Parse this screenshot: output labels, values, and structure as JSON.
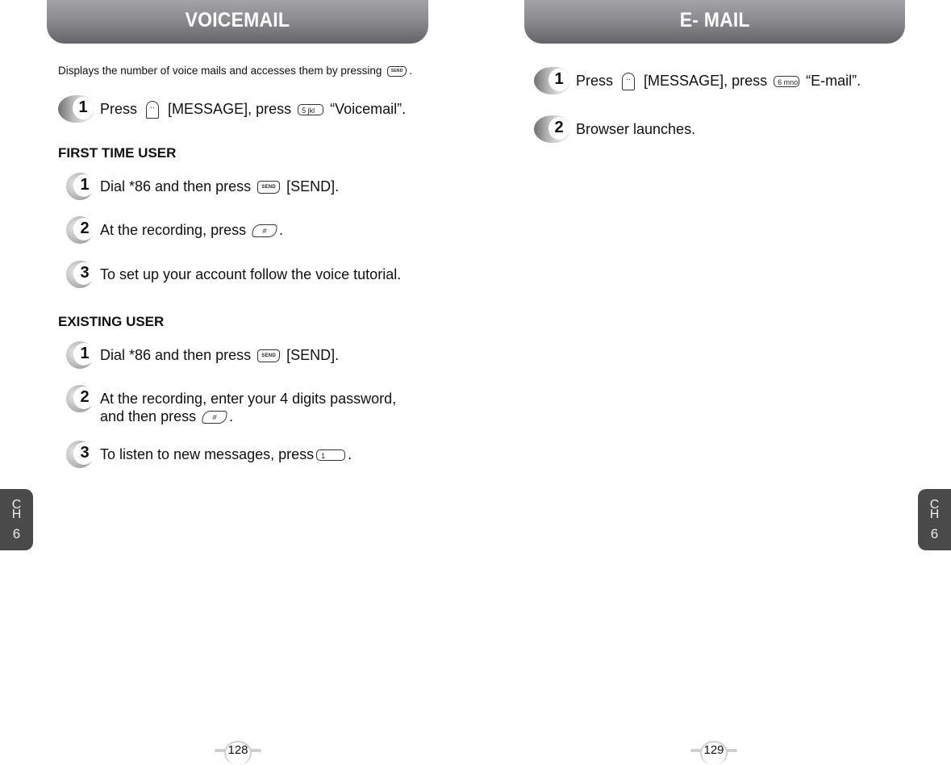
{
  "left_page": {
    "title": "VOICEMAIL",
    "intro": {
      "text_before": "Displays the number of voice mails and accesses them by pressing",
      "key": "SEND",
      "text_after": "."
    },
    "main_step": {
      "number": "1",
      "parts": [
        "Press",
        "[MESSAGE], press",
        "“Voicemail”."
      ],
      "keys": [
        "message-key",
        "5-key"
      ],
      "key_labels": [
        "··",
        "5  jkl"
      ]
    },
    "first_time_user": {
      "heading": "FIRST TIME USER",
      "steps": [
        {
          "number": "1",
          "before": "Dial *86 and then press",
          "key": "SEND",
          "after": "[SEND]."
        },
        {
          "number": "2",
          "before": "At the recording, press",
          "key": "#",
          "after": "."
        },
        {
          "number": "3",
          "text": "To set up your account follow the voice tutorial."
        }
      ]
    },
    "existing_user": {
      "heading": "EXISTING USER",
      "steps": [
        {
          "number": "1",
          "before": "Dial *86 and then press",
          "key": "SEND",
          "after": "[SEND]."
        },
        {
          "number": "2",
          "line1": "At the recording, enter your 4 digits password,",
          "before": "and then press",
          "key": "#",
          "after": "."
        },
        {
          "number": "3",
          "before": "To listen to new messages, press",
          "key": "1",
          "after": "."
        }
      ]
    },
    "chapter_tab": [
      "C",
      "H",
      "6"
    ],
    "page_number": "128"
  },
  "right_page": {
    "title": "E- MAIL",
    "steps": [
      {
        "number": "1",
        "parts": [
          "Press",
          "[MESSAGE], press",
          "“E-mail”."
        ],
        "key_labels": [
          "··",
          "6  mno"
        ]
      },
      {
        "number": "2",
        "text": "Browser launches."
      }
    ],
    "chapter_tab": [
      "C",
      "H",
      "6"
    ],
    "page_number": "129"
  },
  "colors": {
    "header_gradient_top": "#a3a3a7",
    "header_gradient_bottom": "#646468",
    "chapter_tab": "#4a4a4a"
  }
}
